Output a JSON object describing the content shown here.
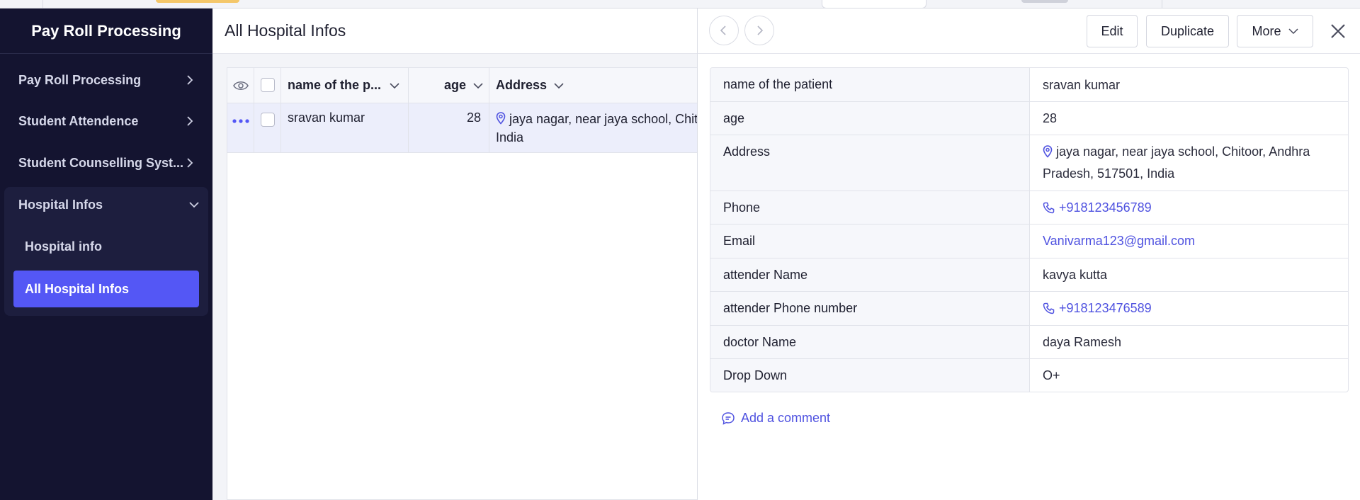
{
  "colors": {
    "sidebar_bg": "#141430",
    "accent": "#5457f5",
    "link": "#4f52e0",
    "row_selected": "#eceefb"
  },
  "sidebar": {
    "app_title": "Pay Roll Processing",
    "items": [
      {
        "label": "Pay Roll Processing",
        "icon": "chevron-right-icon"
      },
      {
        "label": "Student Attendence",
        "icon": "chevron-right-icon"
      },
      {
        "label": "Student Counselling Syst...",
        "icon": "chevron-right-icon"
      },
      {
        "label": "Hospital Infos",
        "icon": "chevron-down-icon",
        "expanded": true
      }
    ],
    "sub_items": [
      {
        "label": "Hospital info",
        "active": false
      },
      {
        "label": "All Hospital Infos",
        "active": true
      }
    ]
  },
  "main": {
    "title": "All Hospital Infos",
    "columns": [
      "name of the p...",
      "age",
      "Address"
    ],
    "rows": [
      {
        "name": "sravan kumar",
        "age": "28",
        "address_line1": "jaya nagar, near jaya school, Chitoor, Andhra",
        "address_line2": "India"
      }
    ]
  },
  "panel": {
    "buttons": {
      "edit": "Edit",
      "duplicate": "Duplicate",
      "more": "More"
    },
    "fields": [
      {
        "label": "name of the patient",
        "value": "sravan kumar"
      },
      {
        "label": "age",
        "value": "28"
      },
      {
        "label": "Address",
        "value": "jaya nagar, near jaya school, Chitoor, Andhra Pradesh, 517501, India",
        "icon": "location-pin-icon"
      },
      {
        "label": "Phone",
        "value": "+918123456789",
        "icon": "phone-icon"
      },
      {
        "label": "Email",
        "value": "Vanivarma123@gmail.com"
      },
      {
        "label": "attender Name",
        "value": "kavya kutta"
      },
      {
        "label": "attender Phone number",
        "value": "+918123476589",
        "icon": "phone-icon"
      },
      {
        "label": "doctor Name",
        "value": "daya Ramesh"
      },
      {
        "label": "Drop Down",
        "value": "O+"
      }
    ],
    "comment_label": "Add a comment"
  }
}
